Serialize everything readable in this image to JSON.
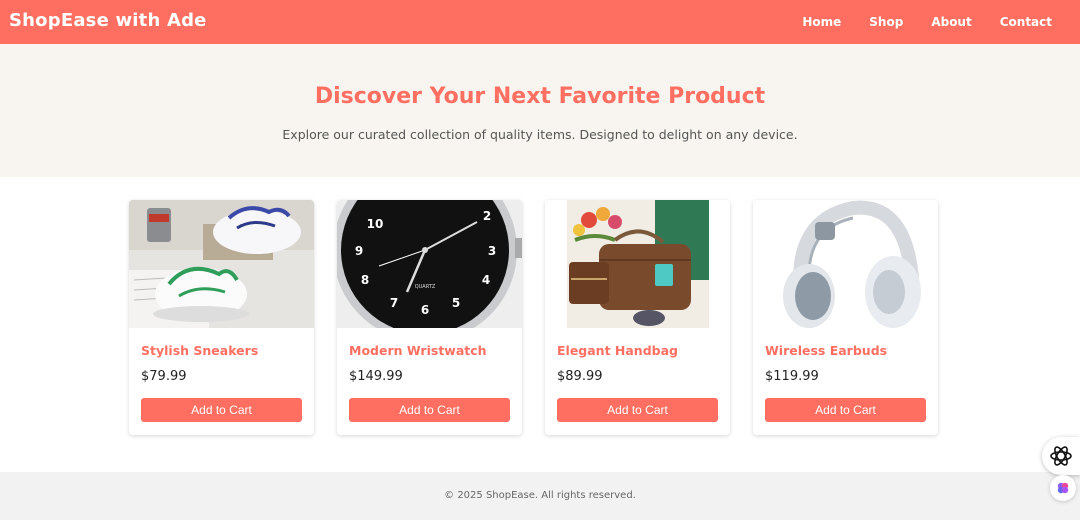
{
  "brand": "ShopEase with Ade",
  "nav": {
    "links": [
      "Home",
      "Shop",
      "About",
      "Contact"
    ]
  },
  "hero": {
    "title": "Discover Your Next Favorite Product",
    "subtitle": "Explore our curated collection of quality items. Designed to delight on any device."
  },
  "products": [
    {
      "name": "Stylish Sneakers",
      "price": "$79.99",
      "button": "Add to Cart",
      "image": "sneakers-photo"
    },
    {
      "name": "Modern Wristwatch",
      "price": "$149.99",
      "button": "Add to Cart",
      "image": "wristwatch-photo"
    },
    {
      "name": "Elegant Handbag",
      "price": "$89.99",
      "button": "Add to Cart",
      "image": "handbag-photo"
    },
    {
      "name": "Wireless Earbuds",
      "price": "$119.99",
      "button": "Add to Cart",
      "image": "headphones-photo"
    }
  ],
  "footer": {
    "text": "© 2025 ShopEase. All rights reserved."
  },
  "colors": {
    "accent": "#ff6f61",
    "hero_bg": "#f8f5f1",
    "footer_bg": "#f2f2f2"
  },
  "icons": {
    "floating_primary": "ai-assistant-icon",
    "floating_secondary": "brain-icon"
  }
}
